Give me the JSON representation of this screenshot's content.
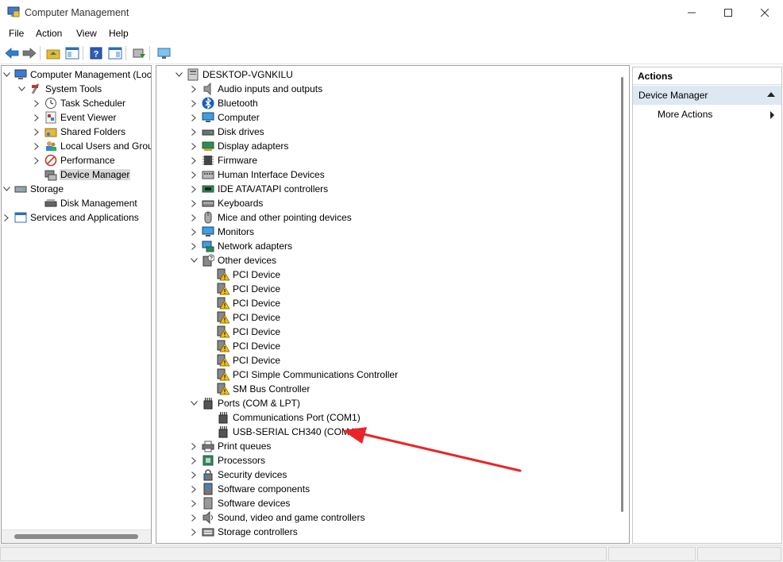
{
  "window": {
    "title": "Computer Management"
  },
  "menu": [
    "File",
    "Action",
    "View",
    "Help"
  ],
  "left_tree": [
    {
      "label": "Computer Management (Local",
      "icon": "computer-management-icon",
      "expander": "expanded",
      "indent": 0
    },
    {
      "label": "System Tools",
      "icon": "system-tools-icon",
      "expander": "expanded",
      "indent": 1
    },
    {
      "label": "Task Scheduler",
      "icon": "clock-icon",
      "expander": "collapsed",
      "indent": 2
    },
    {
      "label": "Event Viewer",
      "icon": "event-viewer-icon",
      "expander": "collapsed",
      "indent": 2
    },
    {
      "label": "Shared Folders",
      "icon": "shared-folder-icon",
      "expander": "collapsed",
      "indent": 2
    },
    {
      "label": "Local Users and Groups",
      "icon": "users-icon",
      "expander": "collapsed",
      "indent": 2
    },
    {
      "label": "Performance",
      "icon": "performance-icon",
      "expander": "collapsed",
      "indent": 2
    },
    {
      "label": "Device Manager",
      "icon": "device-manager-icon",
      "expander": "none",
      "indent": 2,
      "selected": true
    },
    {
      "label": "Storage",
      "icon": "storage-icon",
      "expander": "expanded",
      "indent": 0
    },
    {
      "label": "Disk Management",
      "icon": "disk-management-icon",
      "expander": "none",
      "indent": 2
    },
    {
      "label": "Services and Applications",
      "icon": "services-icon",
      "expander": "collapsed",
      "indent": 0
    }
  ],
  "device_tree": [
    {
      "label": "DESKTOP-VGNKILU",
      "icon": "computer-icon",
      "expander": "expanded",
      "indent": 0
    },
    {
      "label": "Audio inputs and outputs",
      "icon": "speaker-icon",
      "expander": "collapsed",
      "indent": 1
    },
    {
      "label": "Bluetooth",
      "icon": "bluetooth-icon",
      "expander": "collapsed",
      "indent": 1
    },
    {
      "label": "Computer",
      "icon": "monitor-icon",
      "expander": "collapsed",
      "indent": 1
    },
    {
      "label": "Disk drives",
      "icon": "disk-drive-icon",
      "expander": "collapsed",
      "indent": 1
    },
    {
      "label": "Display adapters",
      "icon": "display-adapter-icon",
      "expander": "collapsed",
      "indent": 1
    },
    {
      "label": "Firmware",
      "icon": "firmware-icon",
      "expander": "collapsed",
      "indent": 1
    },
    {
      "label": "Human Interface Devices",
      "icon": "hid-icon",
      "expander": "collapsed",
      "indent": 1
    },
    {
      "label": "IDE ATA/ATAPI controllers",
      "icon": "ide-controller-icon",
      "expander": "collapsed",
      "indent": 1
    },
    {
      "label": "Keyboards",
      "icon": "keyboard-icon",
      "expander": "collapsed",
      "indent": 1
    },
    {
      "label": "Mice and other pointing devices",
      "icon": "mouse-icon",
      "expander": "collapsed",
      "indent": 1
    },
    {
      "label": "Monitors",
      "icon": "monitor-icon",
      "expander": "collapsed",
      "indent": 1
    },
    {
      "label": "Network adapters",
      "icon": "network-adapter-icon",
      "expander": "collapsed",
      "indent": 1
    },
    {
      "label": "Other devices",
      "icon": "other-devices-icon",
      "expander": "expanded",
      "indent": 1
    },
    {
      "label": "PCI Device",
      "icon": "warning-device-icon",
      "expander": "none",
      "indent": 2
    },
    {
      "label": "PCI Device",
      "icon": "warning-device-icon",
      "expander": "none",
      "indent": 2
    },
    {
      "label": "PCI Device",
      "icon": "warning-device-icon",
      "expander": "none",
      "indent": 2
    },
    {
      "label": "PCI Device",
      "icon": "warning-device-icon",
      "expander": "none",
      "indent": 2
    },
    {
      "label": "PCI Device",
      "icon": "warning-device-icon",
      "expander": "none",
      "indent": 2
    },
    {
      "label": "PCI Device",
      "icon": "warning-device-icon",
      "expander": "none",
      "indent": 2
    },
    {
      "label": "PCI Device",
      "icon": "warning-device-icon",
      "expander": "none",
      "indent": 2
    },
    {
      "label": "PCI Simple Communications Controller",
      "icon": "warning-device-icon",
      "expander": "none",
      "indent": 2
    },
    {
      "label": "SM Bus Controller",
      "icon": "warning-device-icon",
      "expander": "none",
      "indent": 2
    },
    {
      "label": "Ports (COM & LPT)",
      "icon": "port-icon",
      "expander": "expanded",
      "indent": 1
    },
    {
      "label": "Communications Port (COM1)",
      "icon": "port-icon",
      "expander": "none",
      "indent": 2
    },
    {
      "label": "USB-SERIAL CH340 (COM4)",
      "icon": "port-icon",
      "expander": "none",
      "indent": 2
    },
    {
      "label": "Print queues",
      "icon": "printer-icon",
      "expander": "collapsed",
      "indent": 1
    },
    {
      "label": "Processors",
      "icon": "processor-icon",
      "expander": "collapsed",
      "indent": 1
    },
    {
      "label": "Security devices",
      "icon": "security-device-icon",
      "expander": "collapsed",
      "indent": 1
    },
    {
      "label": "Software components",
      "icon": "software-component-icon",
      "expander": "collapsed",
      "indent": 1
    },
    {
      "label": "Software devices",
      "icon": "software-device-icon",
      "expander": "collapsed",
      "indent": 1
    },
    {
      "label": "Sound, video and game controllers",
      "icon": "sound-controller-icon",
      "expander": "collapsed",
      "indent": 1
    },
    {
      "label": "Storage controllers",
      "icon": "storage-controller-icon",
      "expander": "collapsed",
      "indent": 1
    }
  ],
  "actions": {
    "header": "Actions",
    "section": "Device Manager",
    "item": "More Actions"
  },
  "annotation": {
    "color": "#e8262a",
    "target": "USB-SERIAL CH340 (COM4)"
  }
}
